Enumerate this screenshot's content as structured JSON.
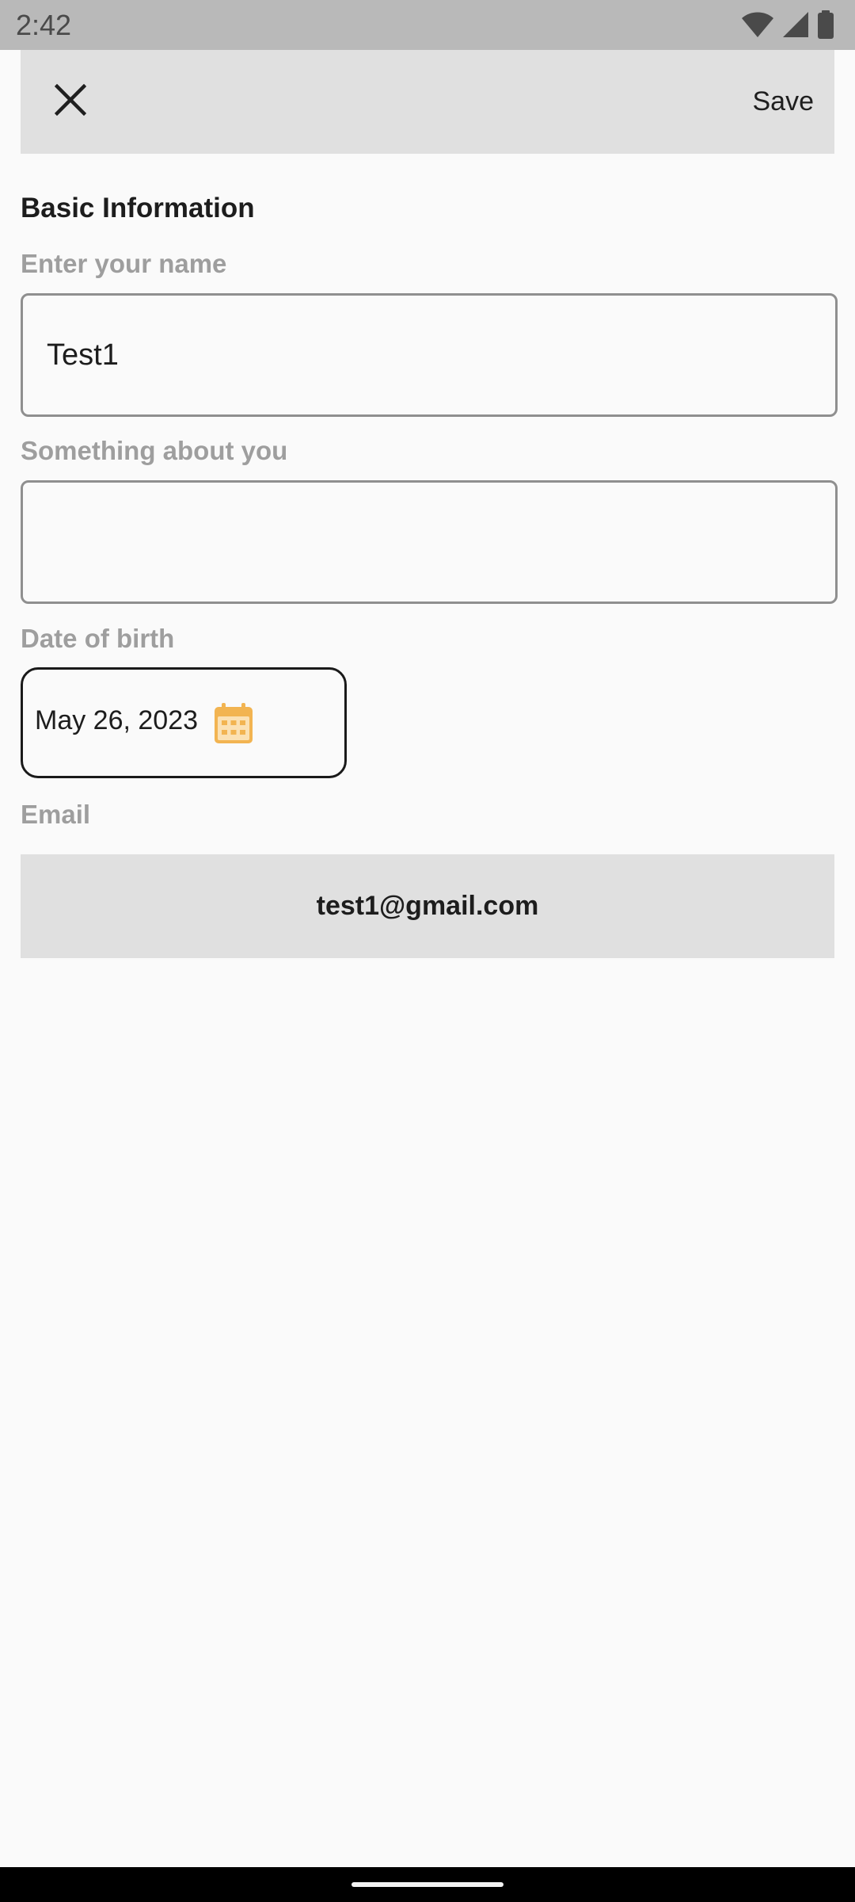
{
  "status_bar": {
    "time": "2:42",
    "icons": [
      "wifi-icon",
      "signal-icon",
      "battery-icon"
    ]
  },
  "app_bar": {
    "close_icon": "close-icon",
    "save_label": "Save"
  },
  "form": {
    "section_title": "Basic Information",
    "name": {
      "label": "Enter your name",
      "value": "Test1",
      "placeholder": ""
    },
    "about": {
      "label": "Something about you",
      "value": "",
      "placeholder": ""
    },
    "dob": {
      "label": "Date of birth",
      "value": "May 26, 2023",
      "icon": "calendar-icon",
      "icon_color": "#f2b451"
    },
    "email": {
      "label": "Email",
      "value": "test1@gmail.com"
    }
  },
  "colors": {
    "background": "#fafafa",
    "app_bar": "#e0e0e0",
    "label": "#9e9e9e",
    "accent": "#f2b451"
  }
}
